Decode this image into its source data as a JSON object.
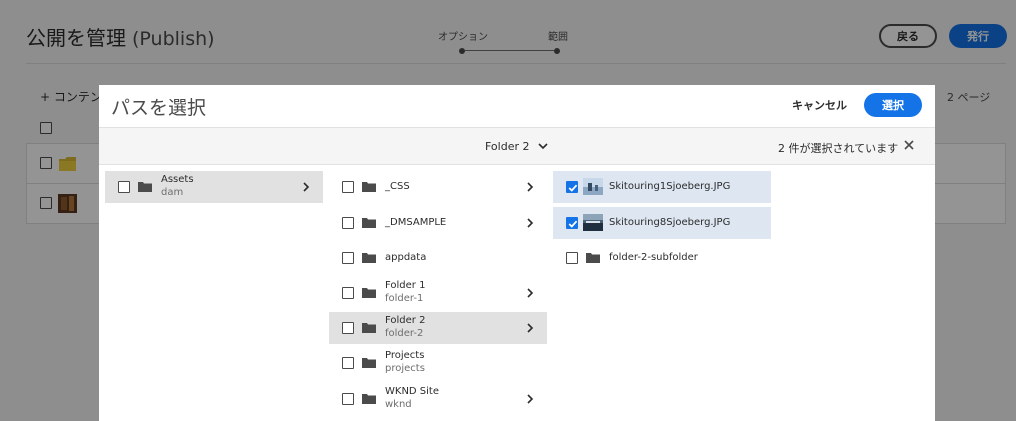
{
  "page": {
    "title": "公開を管理",
    "title_suffix": "(Publish)",
    "steps": [
      "オプション",
      "範囲"
    ],
    "back_label": "戻る",
    "publish_label": "発行",
    "add_content_label": "+ コンテンツ",
    "pages_count": "2 ページ"
  },
  "dialog": {
    "title": "パスを選択",
    "cancel_label": "キャンセル",
    "select_label": "選択",
    "folder_dropdown": "Folder 2",
    "selection_count": "2 件が選択されています"
  },
  "columns": {
    "col1": [
      {
        "name": "Assets",
        "sub": "dam",
        "icon": "folder-icon",
        "has_children": true,
        "active": true,
        "checked": false
      }
    ],
    "col2": [
      {
        "name": "_CSS",
        "sub": "",
        "icon": "folder-icon",
        "has_children": true,
        "active": false,
        "checked": false
      },
      {
        "name": "_DMSAMPLE",
        "sub": "",
        "icon": "folder-icon",
        "has_children": true,
        "active": false,
        "checked": false
      },
      {
        "name": "appdata",
        "sub": "",
        "icon": "folder-icon",
        "has_children": false,
        "active": false,
        "checked": false
      },
      {
        "name": "Folder 1",
        "sub": "folder-1",
        "icon": "folder-icon",
        "has_children": true,
        "active": false,
        "checked": false
      },
      {
        "name": "Folder 2",
        "sub": "folder-2",
        "icon": "folder-icon",
        "has_children": true,
        "active": true,
        "checked": false
      },
      {
        "name": "Projects",
        "sub": "projects",
        "icon": "folder-icon",
        "has_children": false,
        "active": false,
        "checked": false
      },
      {
        "name": "WKND Site",
        "sub": "wknd",
        "icon": "folder-icon",
        "has_children": true,
        "active": false,
        "checked": false
      }
    ],
    "col3": [
      {
        "name": "Skitouring1Sjoeberg.JPG",
        "sub": "",
        "icon": "image-thumbnail",
        "has_children": false,
        "active": false,
        "checked": true
      },
      {
        "name": "Skitouring8Sjoeberg.JPG",
        "sub": "",
        "icon": "image-thumbnail",
        "has_children": false,
        "active": false,
        "checked": true
      },
      {
        "name": "folder-2-subfolder",
        "sub": "",
        "icon": "folder-icon",
        "has_children": false,
        "active": false,
        "checked": false
      }
    ]
  },
  "colors": {
    "accent": "#1473e6",
    "selected_row": "#dde6f1",
    "active_row": "#e1e1e1",
    "overlay": "rgba(0,0,0,0.42)"
  }
}
